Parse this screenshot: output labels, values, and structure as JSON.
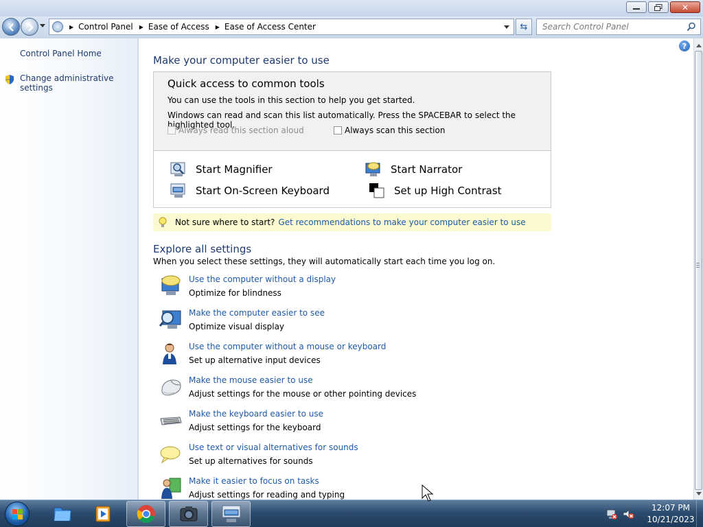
{
  "window": {
    "buttons": {
      "minimize": "minimize",
      "restore": "restore",
      "close": "✕"
    }
  },
  "address_bar": {
    "breadcrumbs": [
      "Control Panel",
      "Ease of Access",
      "Ease of Access Center"
    ],
    "search_placeholder": "Search Control Panel"
  },
  "sidebar": {
    "items": [
      {
        "label": "Control Panel Home"
      },
      {
        "label": "Change administrative settings"
      }
    ]
  },
  "main": {
    "title": "Make your computer easier to use",
    "quick_access": {
      "title": "Quick access to common tools",
      "line1": "You can use the tools in this section to help you get started.",
      "line2": "Windows can read and scan this list automatically.  Press the SPACEBAR to select the highlighted tool.",
      "checkbox_read": "Always read this section aloud",
      "checkbox_scan": "Always scan this section",
      "tools": [
        {
          "label": "Start Magnifier",
          "icon": "magnifier-icon"
        },
        {
          "label": "Start Narrator",
          "icon": "narrator-icon"
        },
        {
          "label": "Start On-Screen Keyboard",
          "icon": "on-screen-keyboard-icon"
        },
        {
          "label": "Set up High Contrast",
          "icon": "high-contrast-icon"
        }
      ]
    },
    "tip": {
      "text": "Not sure where to start?",
      "link": "Get recommendations to make your computer easier to use"
    },
    "explore": {
      "title": "Explore all settings",
      "subtitle": "When you select these settings, they will automatically start each time you log on.",
      "items": [
        {
          "link": "Use the computer without a display",
          "desc": "Optimize for blindness",
          "icon": "speech-monitor-icon"
        },
        {
          "link": "Make the computer easier to see",
          "desc": "Optimize visual display",
          "icon": "magnify-monitor-icon"
        },
        {
          "link": "Use the computer without a mouse or keyboard",
          "desc": "Set up alternative input devices",
          "icon": "person-icon"
        },
        {
          "link": "Make the mouse easier to use",
          "desc": "Adjust settings for the mouse or other pointing devices",
          "icon": "mouse-icon"
        },
        {
          "link": "Make the keyboard easier to use",
          "desc": "Adjust settings for the keyboard",
          "icon": "keyboard-icon"
        },
        {
          "link": "Use text or visual alternatives for sounds",
          "desc": "Set up alternatives for sounds",
          "icon": "speech-bubble-icon"
        },
        {
          "link": "Make it easier to focus on tasks",
          "desc": "Adjust settings for reading and typing",
          "icon": "focus-person-icon"
        }
      ]
    }
  },
  "help_label": "?",
  "taskbar": {
    "time": "12:07 PM",
    "date": "10/21/2023"
  },
  "colors": {
    "link": "#1e5aa8",
    "heading": "#1e3a6e",
    "tip_bg": "#fbf9cf",
    "taskbar": "#2c4b6e"
  }
}
